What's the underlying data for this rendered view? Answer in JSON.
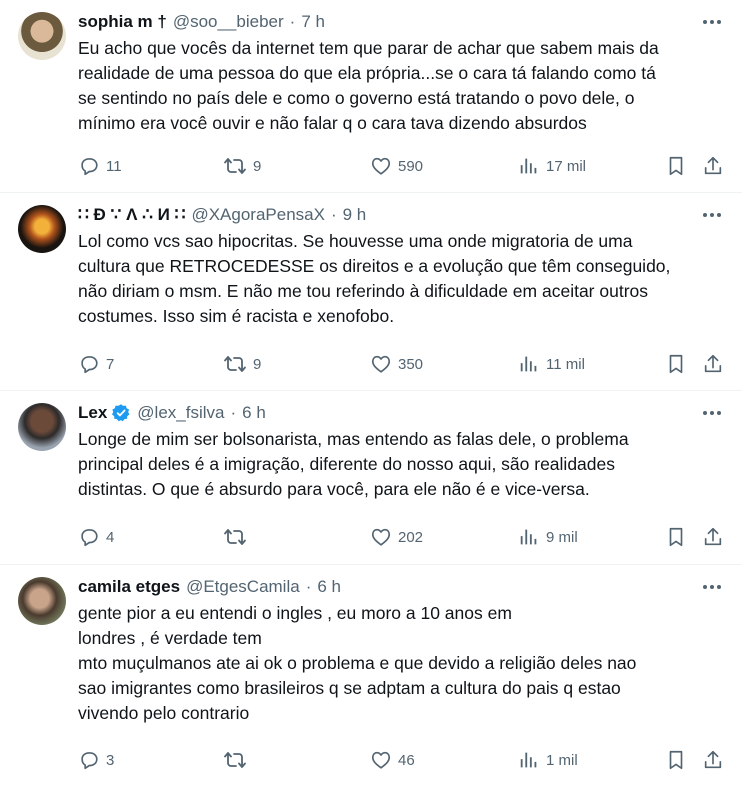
{
  "colors": {
    "text": "#0f1419",
    "muted": "#536471",
    "divider": "#eff3f4",
    "verified": "#1d9bf0"
  },
  "tweets": [
    {
      "name": "sophia m †",
      "handle": "@soo__bieber",
      "time": "7 h",
      "verified": false,
      "lines": [
        "Eu acho que vocês da internet tem que parar de achar que sabem mais da",
        "realidade de uma pessoa do que ela própria...se o cara tá falando como tá",
        "se sentindo no país dele e como o governo está tratando o povo dele, o",
        "mínimo era você ouvir e não falar q o cara tava dizendo absurdos"
      ],
      "replies": "11",
      "retweets": "9",
      "likes": "590",
      "views": "17 mil"
    },
    {
      "name": "∷ Đ ∵ Λ ∴ И ∷",
      "handle": "@XAgoraPensaX",
      "time": "9 h",
      "verified": false,
      "lines": [
        "Lol como vcs sao hipocritas. Se houvesse uma onde migratoria de uma",
        "cultura que RETROCEDESSE os direitos e a evolução que têm conseguido,",
        "não diriam o msm. E não me tou referindo à dificuldade em aceitar outros",
        "costumes. Isso sim é racista e xenofobo."
      ],
      "replies": "7",
      "retweets": "9",
      "likes": "350",
      "views": "11 mil"
    },
    {
      "name": "Lex",
      "handle": "@lex_fsilva",
      "time": "6 h",
      "verified": true,
      "lines": [
        "Longe de mim ser bolsonarista, mas entendo as falas dele, o problema",
        "principal deles é a imigração, diferente do nosso aqui, são realidades",
        "distintas. O que é absurdo para você, para ele não é e vice-versa."
      ],
      "replies": "4",
      "retweets": "",
      "likes": "202",
      "views": "9 mil"
    },
    {
      "name": "camila etges",
      "handle": "@EtgesCamila",
      "time": "6 h",
      "verified": false,
      "lines": [
        "gente pior a eu entendi o ingles , eu moro a 10 anos em",
        "londres , é verdade tem",
        "mto muçulmanos ate ai ok o problema  e que devido a religião deles nao",
        "sao imigrantes como brasileiros q se adptam a cultura do pais q estao",
        "vivendo pelo contrario"
      ],
      "replies": "3",
      "retweets": "",
      "likes": "46",
      "views": "1 mil"
    }
  ]
}
